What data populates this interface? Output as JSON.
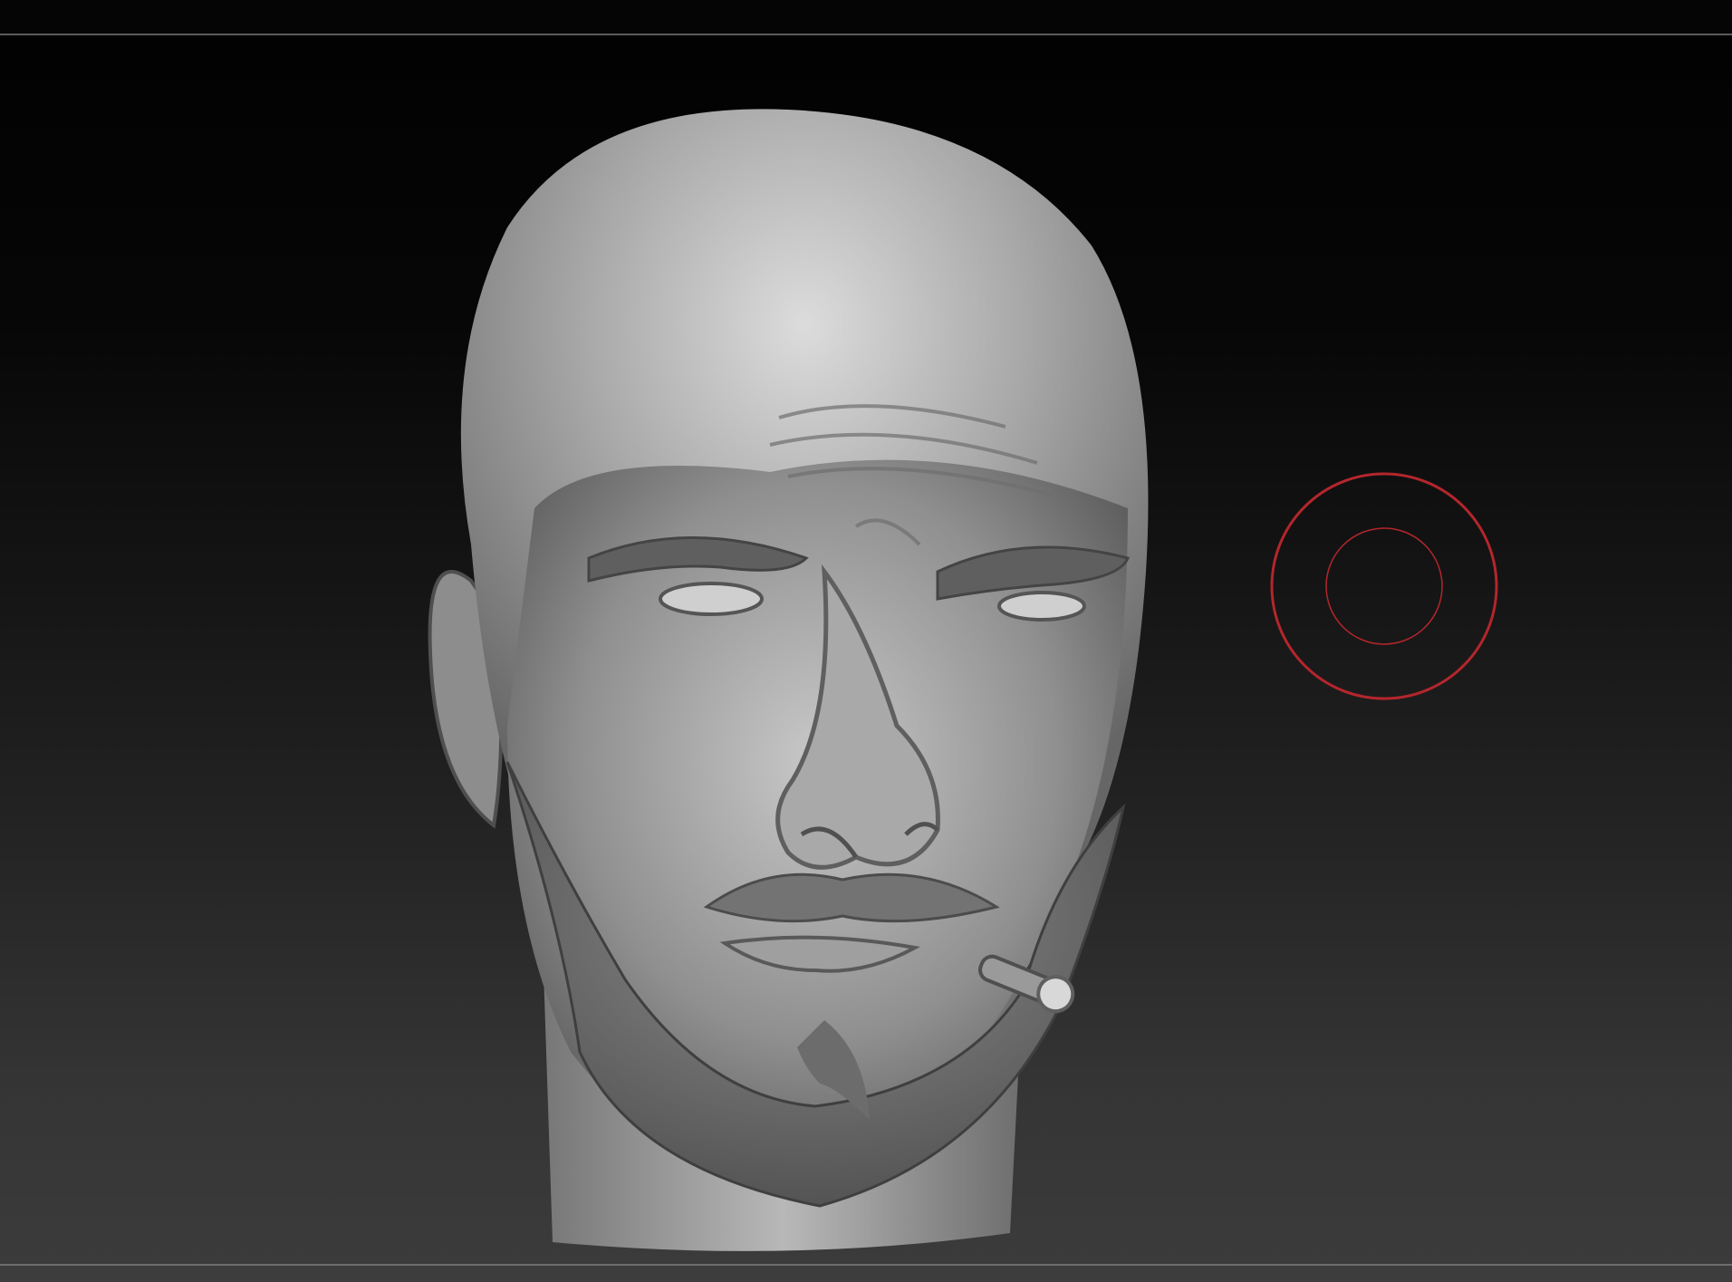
{
  "colors": {
    "background_top": "#020202",
    "background_bottom": "#3b3b3b",
    "separator": "#5b5b5b",
    "brush_ring": "#b3262c",
    "model_clay": "#9c9c9c"
  },
  "viewport": {
    "model_icon": "sculpted-head-model",
    "brush_icon": "brush-cursor-icon"
  }
}
